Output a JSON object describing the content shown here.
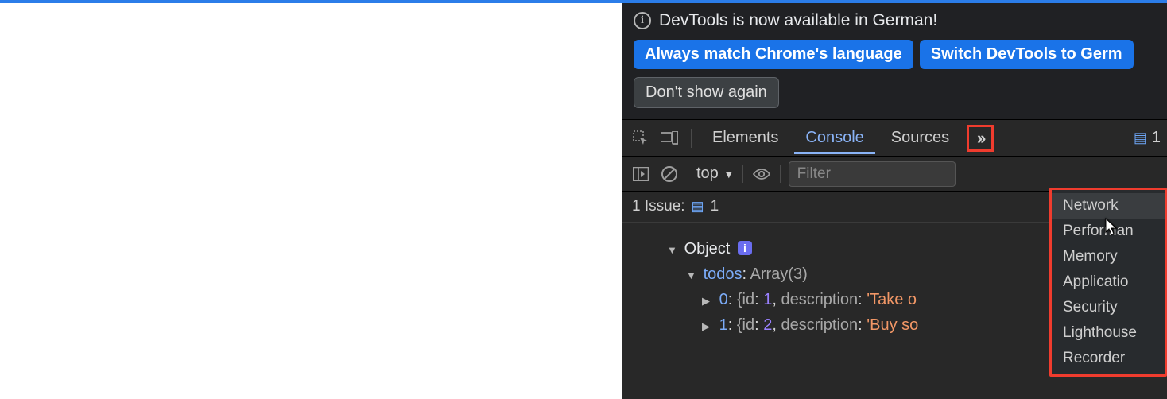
{
  "infobar": {
    "message": "DevTools is now available in German!",
    "primary1": "Always match Chrome's language",
    "primary2": "Switch DevTools to Germ",
    "dismiss": "Don't show again"
  },
  "tabs": {
    "items": [
      "Elements",
      "Console",
      "Sources"
    ],
    "active": "Console",
    "issues_count": "1"
  },
  "toolbar": {
    "context": "top",
    "filter_placeholder": "Filter"
  },
  "issue_line": {
    "label": "1 Issue:",
    "count": "1"
  },
  "console": {
    "object_label": "Object",
    "todos_key": "todos",
    "todos_type": "Array(3)",
    "rows": [
      {
        "idx": "0",
        "id": "1",
        "desc": "'Take o"
      },
      {
        "idx": "1",
        "id": "2",
        "desc": "'Buy so"
      }
    ]
  },
  "dropdown": {
    "items": [
      "Network",
      "Performan",
      "Memory",
      "Applicatio",
      "Security",
      "Lighthouse",
      "Recorder"
    ]
  }
}
